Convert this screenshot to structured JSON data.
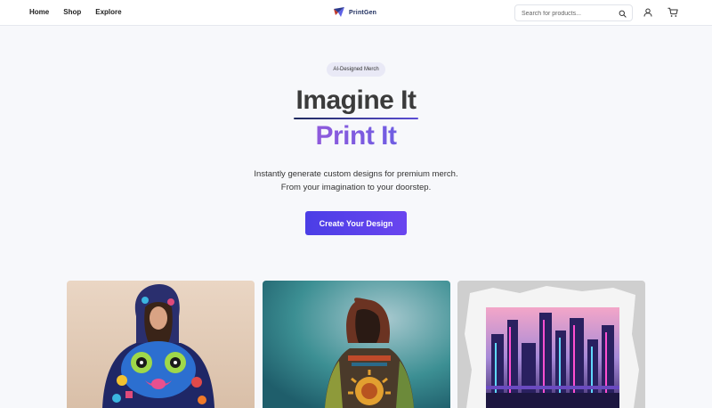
{
  "nav": {
    "items": [
      "Home",
      "Shop",
      "Explore"
    ],
    "brand": "PrintGen"
  },
  "search": {
    "placeholder": "Search for products..."
  },
  "icons": {
    "search": "search-icon",
    "user": "user-icon",
    "cart": "cart-icon",
    "logo": "printgen-logo-icon"
  },
  "hero": {
    "badge": "AI-Designed Merch",
    "headline_line1": "Imagine It",
    "headline_line2": "Print It",
    "subtext_line1": "Instantly generate custom designs for premium merch.",
    "subtext_line2": "From your imagination to your doorstep.",
    "cta_label": "Create Your Design"
  },
  "products": [
    {
      "image": "woman-in-colorful-monster-hoodie"
    },
    {
      "image": "person-in-patterned-hoodie-teal-backdrop"
    },
    {
      "image": "neon-cityscape-print"
    }
  ],
  "colors": {
    "accent": "#5b45ea",
    "headline_gradient_start": "#a35ad8",
    "headline_gradient_end": "#5d61e6",
    "background": "#f7f8fb"
  }
}
